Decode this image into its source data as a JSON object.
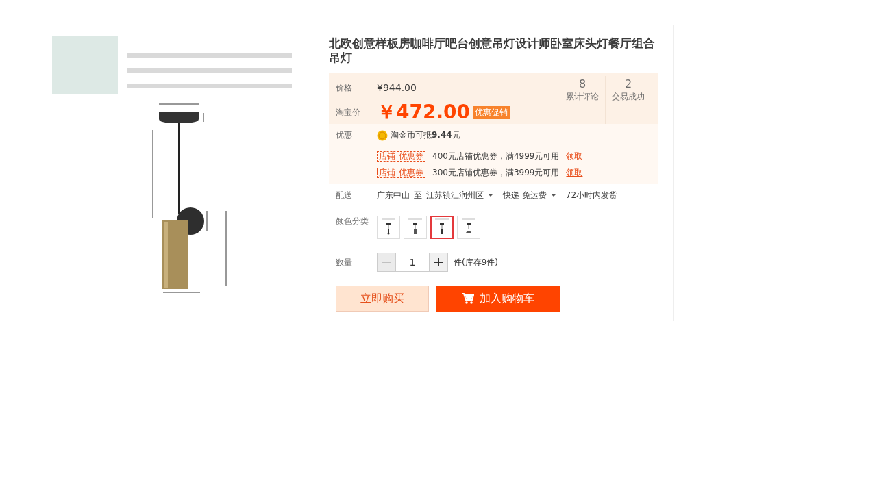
{
  "title": "北欧创意样板房咖啡厅吧台创意吊灯设计师卧室床头灯餐厅组合吊灯",
  "price": {
    "label": "价格",
    "original": "¥944.00",
    "promo_label": "淘宝价",
    "current": "￥472.00",
    "badge": "优惠促销"
  },
  "stats": [
    {
      "value": "8",
      "label": "累计评论"
    },
    {
      "value": "2",
      "label": "交易成功"
    }
  ],
  "discounts": {
    "label": "优惠",
    "coin_text": "淘金币可抵**9.44**元",
    "coupons": [
      {
        "tag_left": "店铺",
        "tag_right": "优惠券",
        "text": "400元店铺优惠券，满4999元可用",
        "action": "领取"
      },
      {
        "tag_left": "店铺",
        "tag_right": "优惠券",
        "text": "300元店铺优惠券，满3999元可用",
        "action": "领取"
      }
    ]
  },
  "delivery": {
    "label": "配送",
    "from": "广东中山",
    "to_word": "至",
    "to": "江苏镇江润州区",
    "method": "快递 免运费",
    "ship_time": "72小时内发货"
  },
  "colors": {
    "label": "颜色分类",
    "options": [
      {
        "selected": false
      },
      {
        "selected": false
      },
      {
        "selected": true
      },
      {
        "selected": false
      }
    ]
  },
  "quantity": {
    "label": "数量",
    "value": "1",
    "decrease_disabled": true,
    "stock": "件(库存9件)"
  },
  "buttons": [
    {
      "kind": "buy",
      "label": "立即购买"
    },
    {
      "kind": "cart",
      "label": "加入购物车"
    }
  ]
}
